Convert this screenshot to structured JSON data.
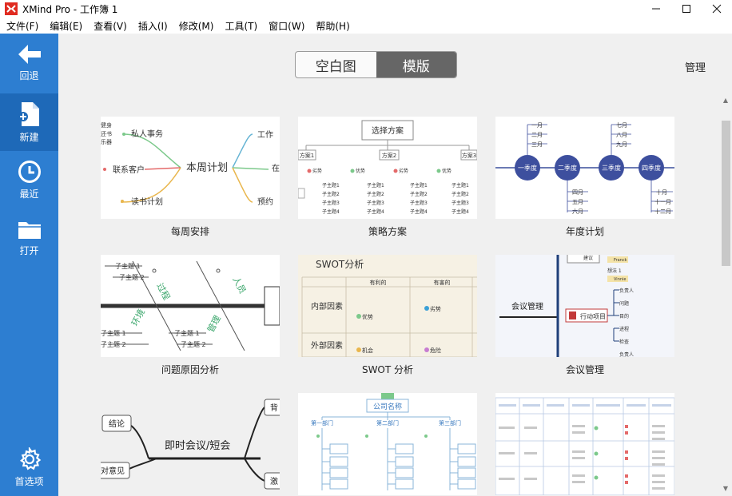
{
  "window": {
    "title": "XMind Pro - 工作簿 1",
    "minimize_icon": "minimize-icon",
    "maximize_icon": "maximize-icon",
    "close_icon": "close-icon"
  },
  "menu": [
    "文件(F)",
    "编辑(E)",
    "查看(V)",
    "插入(I)",
    "修改(M)",
    "工具(T)",
    "窗口(W)",
    "帮助(H)"
  ],
  "sidebar": {
    "items": [
      {
        "label": "回退",
        "icon": "arrow-left-icon"
      },
      {
        "label": "新建",
        "icon": "new-file-icon",
        "active": true
      },
      {
        "label": "最近",
        "icon": "clock-icon"
      },
      {
        "label": "打开",
        "icon": "folder-icon"
      },
      {
        "label": "首选项",
        "icon": "gear-icon"
      }
    ],
    "bg_color": "#2d7ed1",
    "active_color": "#1e69b8"
  },
  "toggle": {
    "options": [
      "空白图",
      "模版"
    ],
    "selected": "模版"
  },
  "manage_label": "管理",
  "templates": [
    {
      "label": "每周安排",
      "center": "本周计划",
      "branches": [
        "私人事务",
        "联系客户",
        "读书计划",
        "工作",
        "在",
        "预约"
      ],
      "leaves": [
        "健身",
        "还书",
        "乐器"
      ]
    },
    {
      "label": "策略方案",
      "root": "选择方案",
      "options": [
        "方案1",
        "方案2",
        "方案3"
      ],
      "items": [
        "劣势",
        "优势",
        "子主题1",
        "子主题2",
        "子主题3",
        "子主题4"
      ]
    },
    {
      "label": "年度计划",
      "quarters": [
        "一季度",
        "二季度",
        "三季度",
        "四季度"
      ],
      "months": [
        "一月",
        "二月",
        "三月",
        "四月",
        "五月",
        "六月",
        "七月",
        "八月",
        "九月",
        "十月",
        "十一月",
        "十二月"
      ]
    },
    {
      "label": "问题原因分析",
      "subtopics": [
        "子主题 1",
        "子主题 2"
      ],
      "branches": [
        "过程",
        "人员",
        "环境",
        "管理"
      ]
    },
    {
      "label": "SWOT 分析",
      "title": "SWOT分析",
      "columns": [
        "有利的",
        "有害的"
      ],
      "rows": [
        "内部因素",
        "外部因素"
      ],
      "cells": [
        "优势",
        "劣势",
        "机会",
        "危险"
      ]
    },
    {
      "label": "会议管理",
      "center": "会议管理",
      "branch": "行动项目",
      "topics": [
        "建议",
        "想法 1",
        "负责人",
        "问题",
        "目的",
        "进程",
        "检查",
        "Franck",
        "Vinnie"
      ]
    },
    {
      "label": "",
      "center": "即时会议/短会",
      "branches": [
        "结论",
        "对意见",
        "背",
        "激"
      ]
    },
    {
      "label": "",
      "root": "公司名称",
      "depts": [
        "第一部门",
        "第二部门",
        "第三部门"
      ]
    },
    {
      "label": "",
      "type": "table"
    }
  ]
}
